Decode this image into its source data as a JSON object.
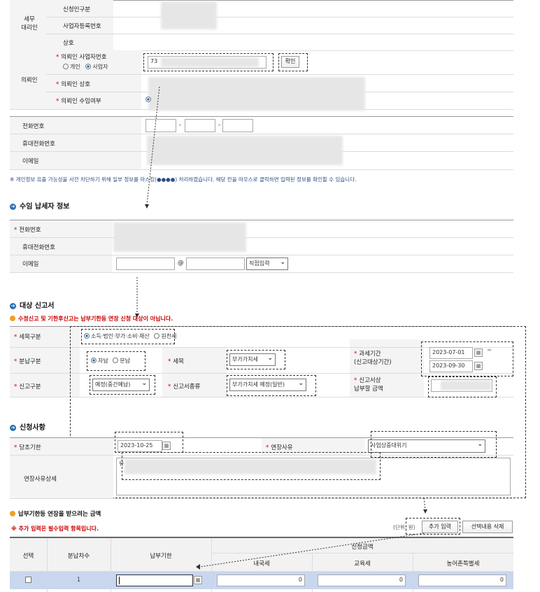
{
  "tax_agent": {
    "group_label": "세무\n대리인",
    "rows": [
      "신청인구분",
      "사업자등록번호",
      "상호"
    ]
  },
  "client": {
    "group_label": "의뢰인",
    "biz_no_label": "의뢰인 사업자번호",
    "type_individual": "개인",
    "type_business": "사업자",
    "biz_no_value": "73",
    "confirm_button": "확인",
    "name_label": "의뢰인 상호",
    "accept_label": "의뢰인 수임여부"
  },
  "contact": {
    "phone_label": "전화번호",
    "mobile_label": "휴대전화번호",
    "email_label": "이메일",
    "dash": "-"
  },
  "privacy_note": "※ 개인정보 유출 가능성을 사전 차단하기 위해 일부 정보를 마스킹(●●●●) 처리하였습니다. 해당 칸을 마우스로 클릭하면 입력된 정보를 확인할 수 있습니다.",
  "taxpayer_section": {
    "title": "수임 납세자 정보",
    "phone_label": "전화번호",
    "mobile_label": "휴대전화번호",
    "email_label": "이메일",
    "at": "@",
    "email_domain_select": "직접입력"
  },
  "return_section": {
    "title": "대상 신고서",
    "warning": "수정신고 및 기한후신고는 납부기한등 연장 신청 대상이 아닙니다.",
    "tax_type_label": "세목구분",
    "tax_type_opt1": "소득·법인·부가·소비·재산",
    "tax_type_opt2": "원천세",
    "split_label": "분납구분",
    "split_opt1": "자납",
    "split_opt2": "분납",
    "item_label": "세목",
    "item_value": "부가가치세",
    "period_label": "과세기간\n(신고대상기간)",
    "period_start": "2023-07-01",
    "period_tilde": "~",
    "period_end": "2023-09-30",
    "filing_type_label": "신고구분",
    "filing_type_value": "예정(중간예납)",
    "form_label": "신고서종류",
    "form_value": "부가가치세 예정(일반)",
    "amount_label": "신고서상\n납부할 금액"
  },
  "request_section": {
    "title": "신청사항",
    "due_label": "당초기한",
    "due_value": "2023-10-25",
    "reason_label": "연장사유",
    "reason_value": "사업상중대위기",
    "detail_label": "연장사유상세",
    "detail_value": "유"
  },
  "amount_section": {
    "title": "납부기한등 연장을 받으려는 금액",
    "required_note": "※ 추가 입력은 필수입력 항목입니다.",
    "unit": "(단위: 원)",
    "add_button": "추가 입력",
    "delete_button": "선택내용 삭제",
    "headers": {
      "select": "선택",
      "installment": "분납차수",
      "due_date": "납부기한",
      "request_amount": "신청금액",
      "national": "내국세",
      "education": "교육세",
      "rural": "농어촌특별세"
    },
    "rows": [
      {
        "installment": "1",
        "due_date": "",
        "national": "0",
        "education": "0",
        "rural": "0"
      }
    ]
  },
  "colors": {
    "accent_blue": "#2a6fb0",
    "required_red": "#cc0000",
    "row_highlight": "#c9d7ee"
  }
}
